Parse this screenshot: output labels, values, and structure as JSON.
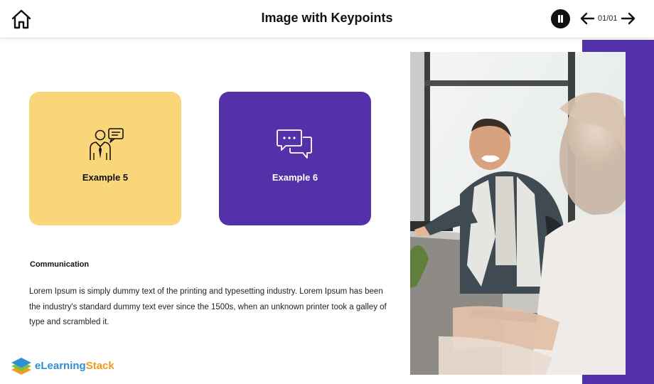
{
  "header": {
    "title": "Image with Keypoints",
    "page_indicator": "01/01",
    "icons": {
      "home": "home-icon",
      "pause": "pause-icon",
      "prev": "arrow-left-icon",
      "next": "arrow-right-icon"
    }
  },
  "cards": [
    {
      "label": "Example 5",
      "icon": "person-speech-icon",
      "color": "#fad67b"
    },
    {
      "label": "Example 6",
      "icon": "chat-bubbles-icon",
      "color": "#5431a9"
    }
  ],
  "content": {
    "heading": "Communication",
    "body": "Lorem Ipsum is simply dummy text of the printing and typesetting industry. Lorem Ipsum has been the industry's standard dummy text ever since the 1500s, when an unknown printer took a galley of type and scrambled it."
  },
  "brand": {
    "part1": "eLearning",
    "part2": "Stack",
    "colors": {
      "part1": "#2f8fd6",
      "part2": "#f39a1f"
    }
  },
  "colors": {
    "accent": "#5431a9",
    "card_yellow": "#fad67b"
  }
}
